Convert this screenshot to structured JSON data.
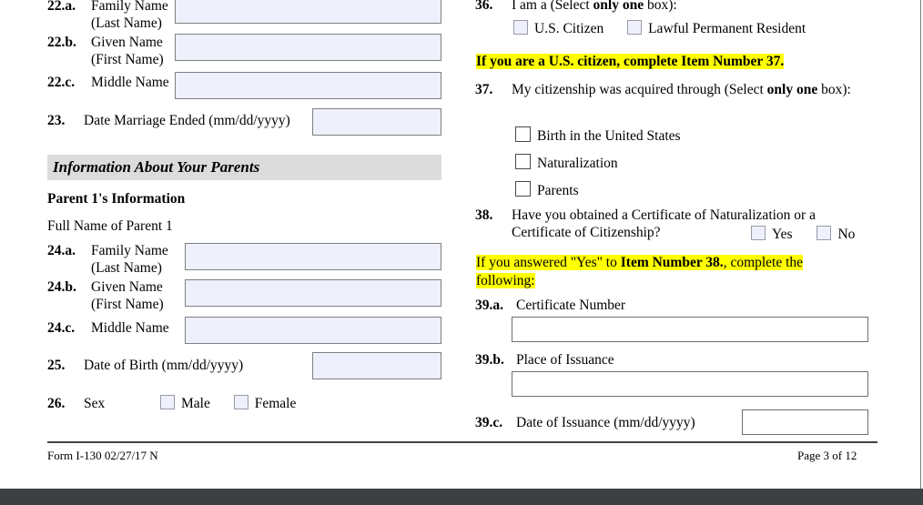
{
  "page": {
    "form_number": "Form I-130",
    "form_date": "02/27/17",
    "form_edition": "N",
    "page_label": "Page 3 of 12",
    "footer_left": "Form I-130   02/27/17   N"
  },
  "colors": {
    "field_fill": "#eef0fb",
    "field_border": "#808080",
    "section_band": "#dcdcdc",
    "highlight": "#ffff00",
    "viewer_chrome": "#3c4043"
  },
  "left_column": {
    "item22a": {
      "number": "22.a.",
      "label_line1": "Family Name",
      "label_line2": "(Last Name)"
    },
    "item22b": {
      "number": "22.b.",
      "label_line1": "Given Name",
      "label_line2": "(First Name)"
    },
    "item22c": {
      "number": "22.c.",
      "label_line1": "Middle Name",
      "label_line2": ""
    },
    "item23": {
      "number": "23.",
      "label": "Date Marriage Ended (mm/dd/yyyy)"
    },
    "section_header": "Information About Your Parents",
    "parent1_subhead": "Parent 1's Information",
    "parent1_fullname_label": "Full Name of Parent 1",
    "item24a": {
      "number": "24.a.",
      "label_line1": "Family Name",
      "label_line2": "(Last Name)"
    },
    "item24b": {
      "number": "24.b.",
      "label_line1": "Given Name",
      "label_line2": "(First Name)"
    },
    "item24c": {
      "number": "24.c.",
      "label_line1": "Middle Name",
      "label_line2": ""
    },
    "item25": {
      "number": "25.",
      "label": "Date of Birth (mm/dd/yyyy)"
    },
    "item26": {
      "number": "26.",
      "label": "Sex",
      "options": [
        {
          "label": "Male",
          "checked": false
        },
        {
          "label": "Female",
          "checked": false
        }
      ]
    }
  },
  "right_column": {
    "item36": {
      "number": "36.",
      "prompt_pre": "I am a (Select ",
      "prompt_bold": "only one",
      "prompt_post": " box):",
      "options": [
        {
          "label": "U.S. Citizen",
          "checked": false
        },
        {
          "label": "Lawful Permanent Resident",
          "checked": false
        }
      ]
    },
    "highlight_37": {
      "text": "If you are a U.S. citizen, complete Item Number 37.",
      "bold": true
    },
    "item37": {
      "number": "37.",
      "prompt_pre": "My citizenship was acquired through (Select ",
      "prompt_bold": "only one",
      "prompt_post": " box):",
      "options": [
        {
          "label": "Birth in the United States",
          "checked": false
        },
        {
          "label": "Naturalization",
          "checked": false
        },
        {
          "label": "Parents",
          "checked": false
        }
      ]
    },
    "item38": {
      "number": "38.",
      "label_line1": "Have you obtained a Certificate of Naturalization or a",
      "label_line2": "Certificate of Citizenship?",
      "options": [
        {
          "label": "Yes",
          "checked": false
        },
        {
          "label": "No",
          "checked": false
        }
      ]
    },
    "highlight_38": {
      "pre": "If you answered \"Yes\" to ",
      "bold": "Item Number 38.",
      "post": ", complete the following:"
    },
    "item39a": {
      "number": "39.a.",
      "label": "Certificate Number",
      "value": ""
    },
    "item39b": {
      "number": "39.b.",
      "label": "Place of Issuance",
      "value": ""
    },
    "item39c": {
      "number": "39.c.",
      "label": "Date of Issuance (mm/dd/yyyy)",
      "value": ""
    }
  }
}
